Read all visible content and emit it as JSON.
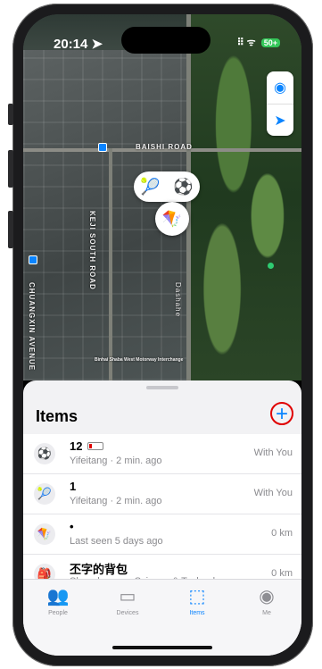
{
  "status": {
    "time": "20:14 ➤",
    "signal": "⠿ ᯤ",
    "battery": "50+"
  },
  "map": {
    "labels": [
      "BAISHI ROAD",
      "KEJI SOUTH ROAD",
      "CHUANGXIN AVENUE",
      "Dashahe",
      "Binhai Shaba West Motorway Interchange"
    ],
    "pin_pair": [
      "🎾",
      "⚽"
    ],
    "pin_kite": "🪁",
    "buttons": {
      "globe": "◉",
      "locate": "➤"
    }
  },
  "sheet": {
    "title": "Items",
    "add": "+"
  },
  "items": [
    {
      "icon": "⚽",
      "name": "12",
      "sub": "Yifeitang · 2 min. ago",
      "right": "With You",
      "low_battery": true
    },
    {
      "icon": "🎾",
      "name": "1",
      "sub": "Yifeitang · 2 min. ago",
      "right": "With You",
      "low_battery": false
    },
    {
      "icon": "🪁",
      "name": "•",
      "sub": "Last seen 5 days ago",
      "right": "0 km",
      "low_battery": false
    },
    {
      "icon": "🎒",
      "name": "丕字的背包",
      "sub": "Shenzhenwan Science & Technology",
      "right": "0 km",
      "low_battery": false
    }
  ],
  "tabs": [
    {
      "icon": "👥",
      "label": "People",
      "active": false
    },
    {
      "icon": "▭",
      "label": "Devices",
      "active": false
    },
    {
      "icon": "⬚",
      "label": "Items",
      "active": true
    },
    {
      "icon": "◉",
      "label": "Me",
      "active": false
    }
  ],
  "colors": {
    "accent": "#0a84ff",
    "highlight": "#e00000"
  }
}
